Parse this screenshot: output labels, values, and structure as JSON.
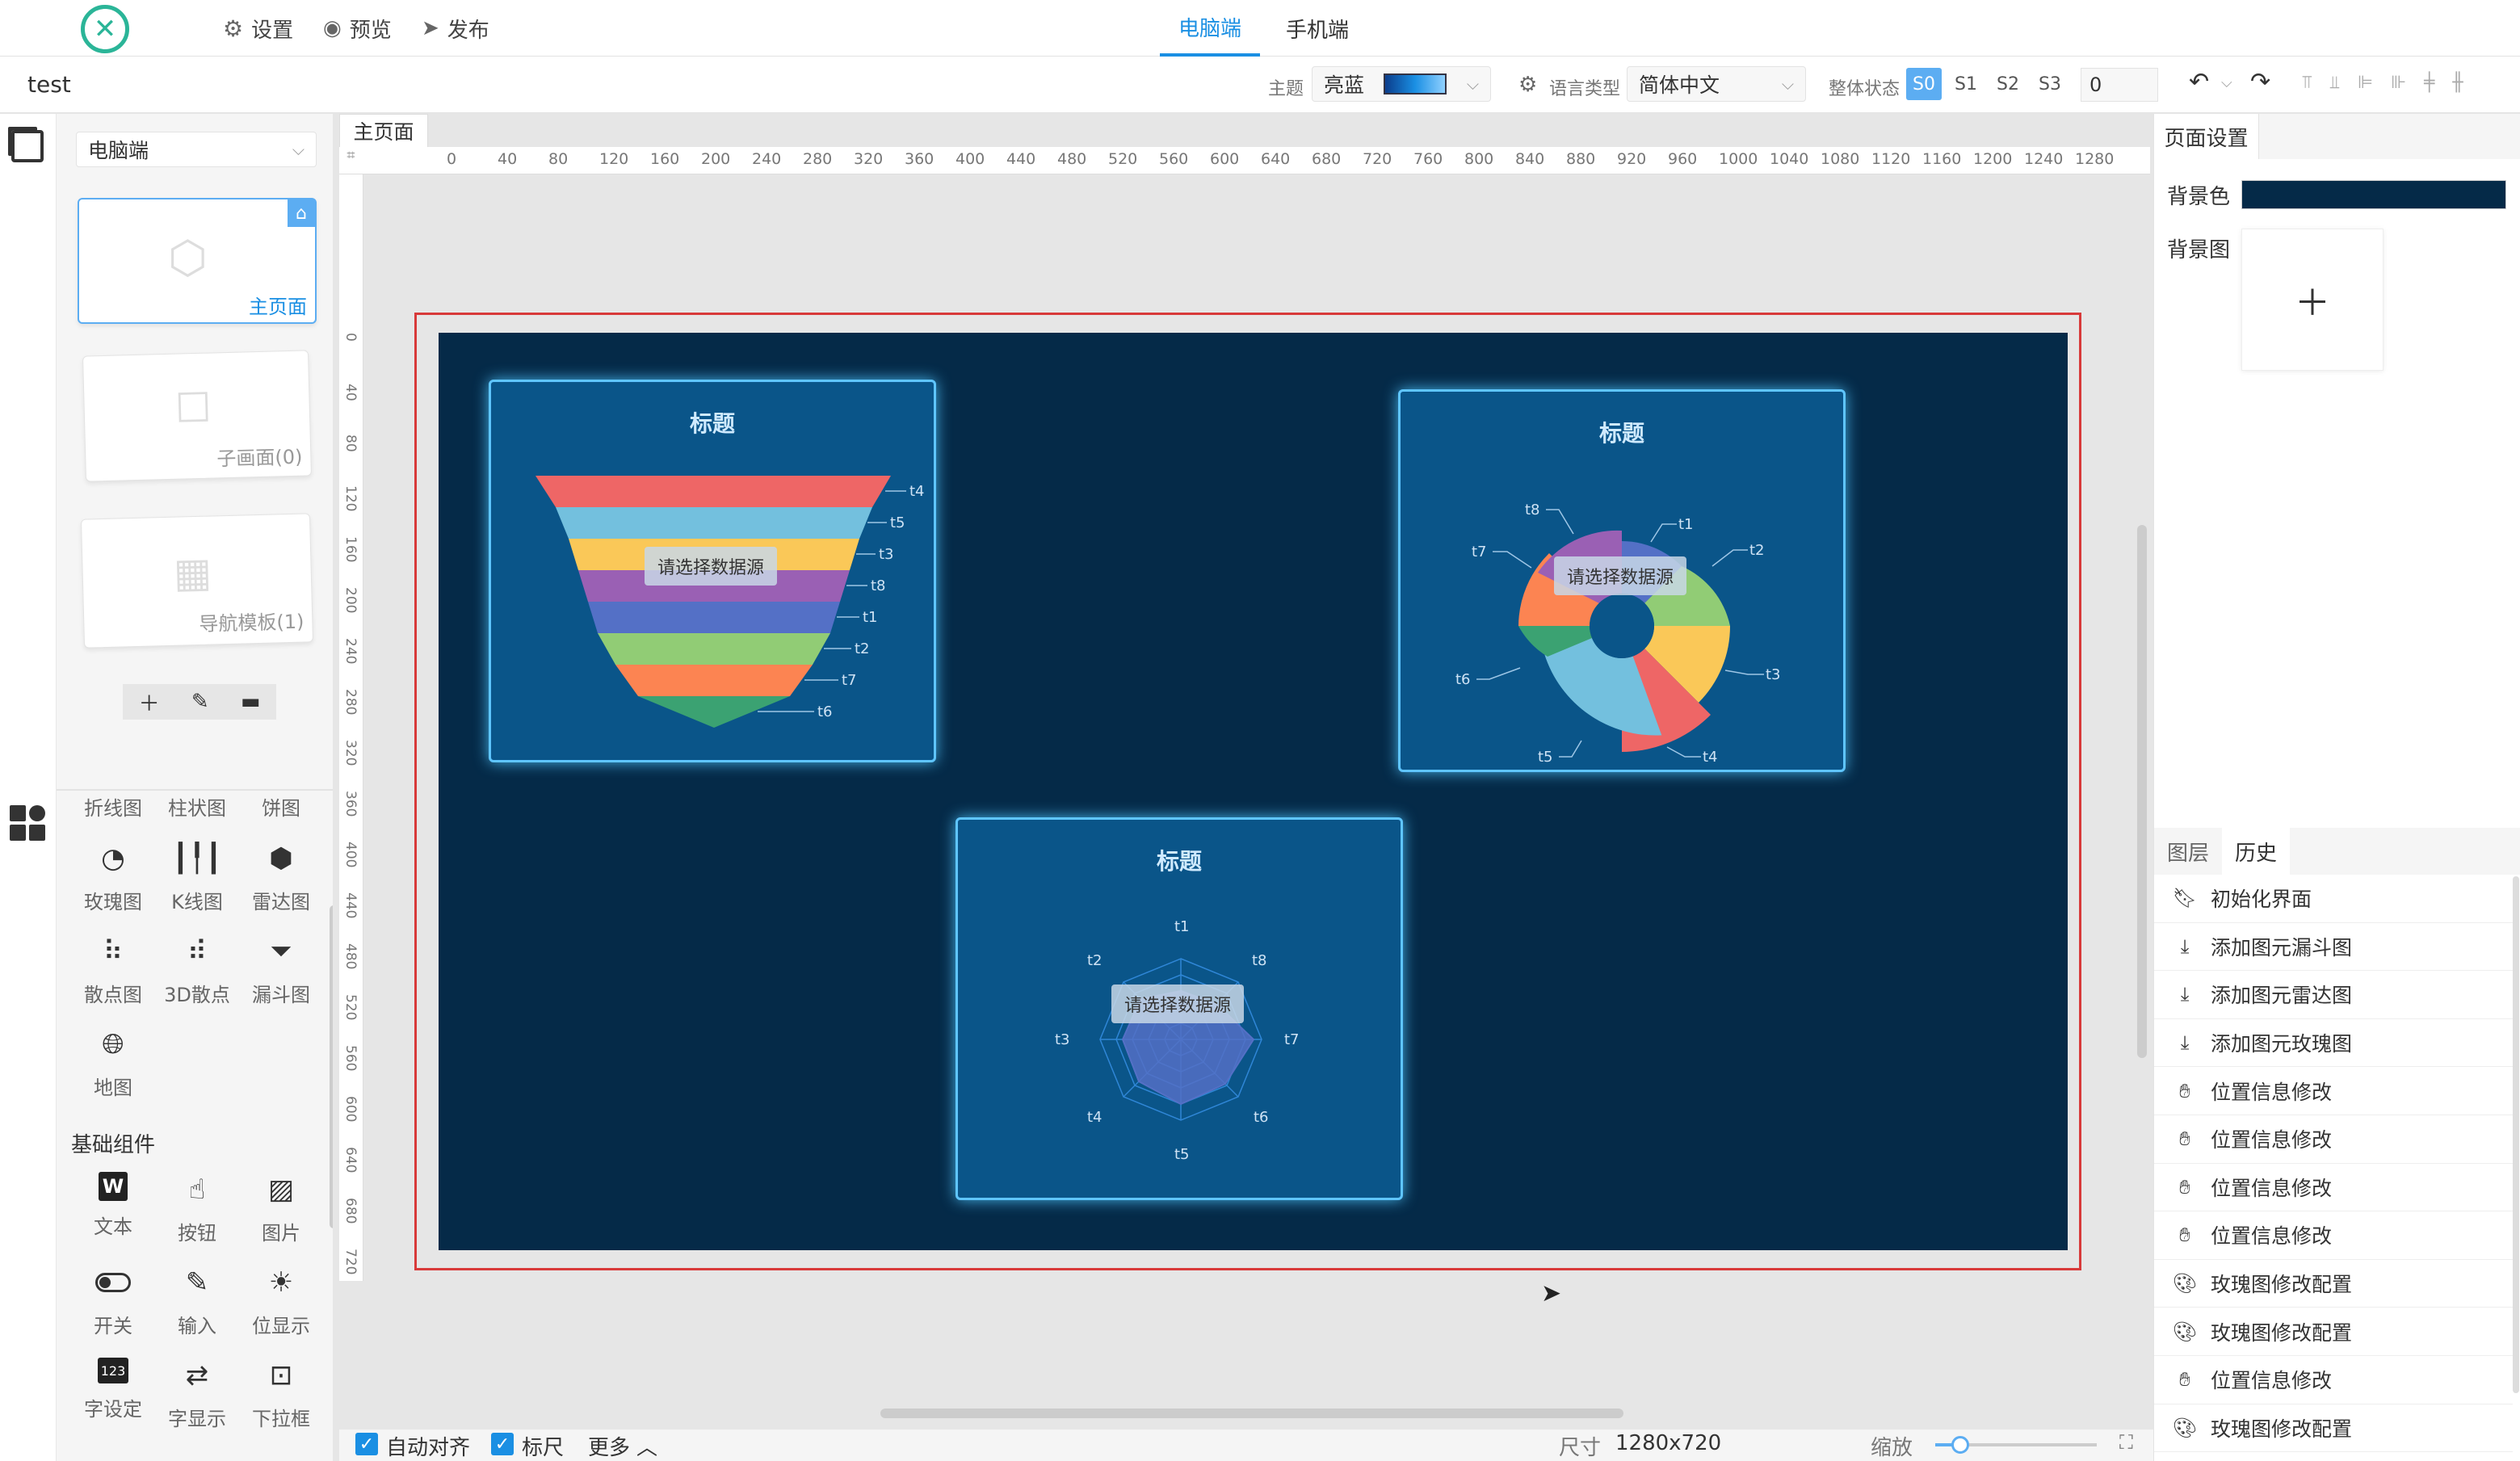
{
  "header": {
    "menu": [
      {
        "icon": "gear-icon",
        "label": "设置"
      },
      {
        "icon": "eye-icon",
        "label": "预览"
      },
      {
        "icon": "send-icon",
        "label": "发布"
      }
    ],
    "device_tabs": [
      "电脑端",
      "手机端"
    ],
    "active_device": "电脑端"
  },
  "toolbar": {
    "project_name": "test",
    "theme_label": "主题",
    "theme_value": "亮蓝",
    "language_label": "语言类型",
    "language_value": "简体中文",
    "state_label": "整体状态",
    "states": [
      "S0",
      "S1",
      "S2",
      "S3"
    ],
    "active_state": "S0",
    "state_input": "0"
  },
  "left_panel": {
    "device_select": "电脑端",
    "pages": [
      {
        "label": "主页面",
        "icon": "box-icon"
      },
      {
        "label": "子画面(0)",
        "icon": "message-icon"
      },
      {
        "label": "导航模板(1)",
        "icon": "layout-icon"
      }
    ],
    "chart_components_top": [
      "折线图",
      "柱状图",
      "饼图"
    ],
    "chart_components": [
      {
        "icon": "rose-icon",
        "label": "玫瑰图"
      },
      {
        "icon": "candlestick-icon",
        "label": "K线图"
      },
      {
        "icon": "hexagon-icon",
        "label": "雷达图"
      },
      {
        "icon": "scatter-icon",
        "label": "散点图"
      },
      {
        "icon": "scatter3d-icon",
        "label": "3D散点"
      },
      {
        "icon": "funnel-icon",
        "label": "漏斗图"
      },
      {
        "icon": "globe-icon",
        "label": "地图"
      }
    ],
    "basic_section_title": "基础组件",
    "basic_components": [
      {
        "icon": "text-icon",
        "label": "文本"
      },
      {
        "icon": "pointer-icon",
        "label": "按钮"
      },
      {
        "icon": "image-icon",
        "label": "图片"
      },
      {
        "icon": "toggle-icon",
        "label": "开关"
      },
      {
        "icon": "pencil-icon",
        "label": "输入"
      },
      {
        "icon": "sun-icon",
        "label": "位显示"
      },
      {
        "icon": "number-icon",
        "label": "字设定"
      },
      {
        "icon": "swap-icon",
        "label": "字显示"
      },
      {
        "icon": "dropdown-icon",
        "label": "下拉框"
      }
    ]
  },
  "canvas": {
    "tab": "主页面",
    "ruler_h": [
      "0",
      "40",
      "80",
      "120",
      "160",
      "200",
      "240",
      "280",
      "320",
      "360",
      "400",
      "440",
      "480",
      "520",
      "560",
      "600",
      "640",
      "680",
      "720",
      "760",
      "800",
      "840",
      "880",
      "920",
      "960",
      "1000",
      "1040",
      "1080",
      "1120",
      "1160",
      "1200",
      "1240",
      "1280"
    ],
    "ruler_v": [
      "0",
      "40",
      "80",
      "120",
      "160",
      "200",
      "240",
      "280",
      "320",
      "360",
      "400",
      "440",
      "480",
      "520",
      "560",
      "600",
      "640",
      "680",
      "720"
    ],
    "stage_color": "#052a48",
    "widgets": [
      {
        "title": "标题",
        "placeholder": "请选择数据源",
        "labels": [
          "t4",
          "t5",
          "t3",
          "t8",
          "t1",
          "t2",
          "t7",
          "t6"
        ]
      },
      {
        "title": "标题",
        "placeholder": "请选择数据源",
        "labels": [
          "t1",
          "t2",
          "t3",
          "t4",
          "t5",
          "t6",
          "t7",
          "t8"
        ]
      },
      {
        "title": "标题",
        "placeholder": "请选择数据源",
        "labels": [
          "t1",
          "t8",
          "t7",
          "t6",
          "t5",
          "t4",
          "t3",
          "t2"
        ]
      }
    ]
  },
  "bottom": {
    "auto_align": "自动对齐",
    "ruler": "标尺",
    "more": "更多",
    "size_label": "尺寸",
    "size_value": "1280x720",
    "zoom_label": "缩放"
  },
  "right_panel": {
    "page_settings_tab": "页面设置",
    "bg_color_label": "背景色",
    "bg_color": "#052a48",
    "bg_image_label": "背景图",
    "tabs": [
      "图层",
      "历史"
    ],
    "active_tab": "历史",
    "history": [
      {
        "icon": "bookmark-icon",
        "label": "初始化界面"
      },
      {
        "icon": "download-icon",
        "label": "添加图元漏斗图"
      },
      {
        "icon": "download-icon",
        "label": "添加图元雷达图"
      },
      {
        "icon": "download-icon",
        "label": "添加图元玫瑰图"
      },
      {
        "icon": "hand-icon",
        "label": "位置信息修改"
      },
      {
        "icon": "hand-icon",
        "label": "位置信息修改"
      },
      {
        "icon": "hand-icon",
        "label": "位置信息修改"
      },
      {
        "icon": "hand-icon",
        "label": "位置信息修改"
      },
      {
        "icon": "palette-icon",
        "label": "玫瑰图修改配置"
      },
      {
        "icon": "palette-icon",
        "label": "玫瑰图修改配置"
      },
      {
        "icon": "hand-icon",
        "label": "位置信息修改"
      },
      {
        "icon": "palette-icon",
        "label": "玫瑰图修改配置"
      }
    ]
  }
}
